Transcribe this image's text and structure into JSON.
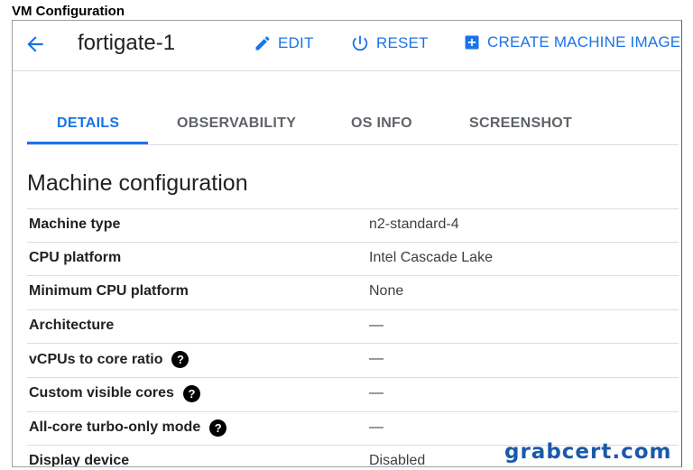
{
  "caption": "VM Configuration",
  "header": {
    "vm_name": "fortigate-1",
    "actions": [
      {
        "label": "EDIT",
        "icon": "pencil-icon"
      },
      {
        "label": "RESET",
        "icon": "power-reset-icon"
      },
      {
        "label": "CREATE MACHINE IMAGE",
        "icon": "add-box-icon"
      }
    ]
  },
  "tabs": [
    {
      "label": "DETAILS",
      "active": true
    },
    {
      "label": "OBSERVABILITY",
      "active": false
    },
    {
      "label": "OS INFO",
      "active": false
    },
    {
      "label": "SCREENSHOT",
      "active": false
    }
  ],
  "section": {
    "title": "Machine configuration",
    "rows": [
      {
        "label": "Machine type",
        "value": "n2-standard-4",
        "help": false
      },
      {
        "label": "CPU platform",
        "value": "Intel Cascade Lake",
        "help": false
      },
      {
        "label": "Minimum CPU platform",
        "value": "None",
        "help": false
      },
      {
        "label": "Architecture",
        "value": "—",
        "help": false
      },
      {
        "label": "vCPUs to core ratio",
        "value": "—",
        "help": true
      },
      {
        "label": "Custom visible cores",
        "value": "—",
        "help": true
      },
      {
        "label": "All-core turbo-only mode",
        "value": "—",
        "help": true
      },
      {
        "label": "Display device",
        "value": "Disabled",
        "help": false
      }
    ]
  },
  "help_glyph": "?",
  "watermark": "grabcert.com",
  "colors": {
    "accent": "#1a73e8",
    "divider": "#dadce0",
    "watermark": "#1a5aa8"
  }
}
